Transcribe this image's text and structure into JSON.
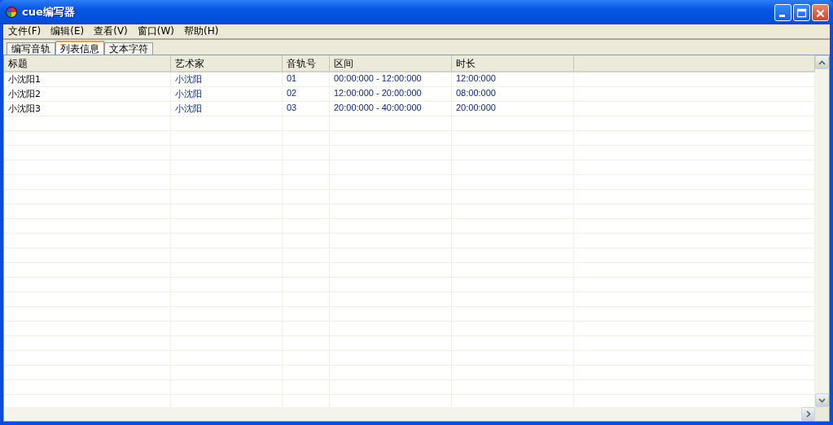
{
  "window": {
    "title": "cue编写器"
  },
  "menu": [
    {
      "label": "文件(F)"
    },
    {
      "label": "编辑(E)"
    },
    {
      "label": "查看(V)"
    },
    {
      "label": "窗口(W)"
    },
    {
      "label": "帮助(H)"
    }
  ],
  "tabs": [
    {
      "label": "编写音轨",
      "selected": false
    },
    {
      "label": "列表信息",
      "selected": true
    },
    {
      "label": "文本字符",
      "selected": false
    }
  ],
  "table": {
    "columns": [
      "标题",
      "艺术家",
      "音轨号",
      "区间",
      "时长"
    ],
    "rows": [
      [
        "小沈阳1",
        "小沈阳",
        "01",
        "00:00:000 - 12:00:000",
        "12:00:000"
      ],
      [
        "小沈阳2",
        "小沈阳",
        "02",
        "12:00:000 - 20:00:000",
        "08:00:000"
      ],
      [
        "小沈阳3",
        "小沈阳",
        "03",
        "20:00:000 - 40:00:000",
        "20:00:000"
      ]
    ]
  }
}
